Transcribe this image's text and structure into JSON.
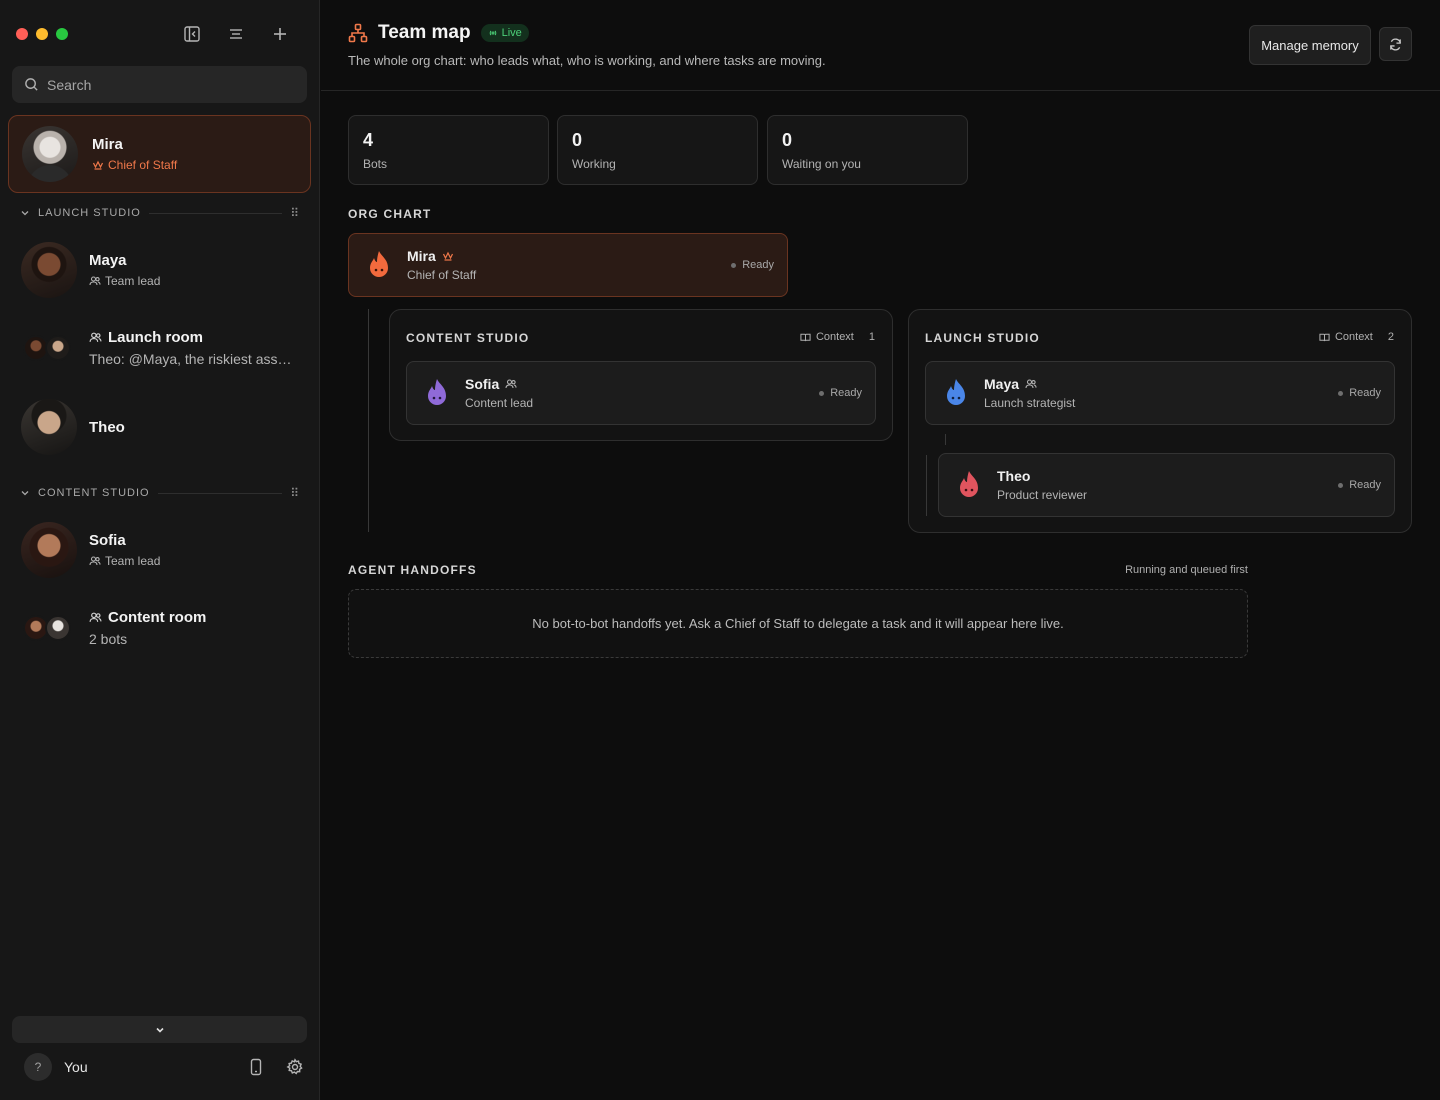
{
  "sidebar": {
    "search_placeholder": "Search",
    "pinned": {
      "name": "Mira",
      "role": "Chief of Staff"
    },
    "sections": [
      {
        "title": "LAUNCH STUDIO",
        "items": [
          {
            "name": "Maya",
            "sub": "Team lead",
            "kind": "bot"
          },
          {
            "name": "Launch room",
            "sub": "Theo: @Maya, the riskiest assu...",
            "kind": "room"
          },
          {
            "name": "Theo",
            "sub": "",
            "kind": "bot"
          }
        ]
      },
      {
        "title": "CONTENT STUDIO",
        "items": [
          {
            "name": "Sofia",
            "sub": "Team lead",
            "kind": "bot"
          },
          {
            "name": "Content room",
            "sub": "2 bots",
            "kind": "room"
          }
        ]
      }
    ],
    "footer": {
      "avatar_glyph": "?",
      "user_label": "You"
    }
  },
  "header": {
    "title": "Team map",
    "live_label": "Live",
    "subtitle": "The whole org chart: who leads what, who is working, and where tasks are moving.",
    "manage_memory_label": "Manage memory"
  },
  "stats": [
    {
      "value": "4",
      "label": "Bots"
    },
    {
      "value": "0",
      "label": "Working"
    },
    {
      "value": "0",
      "label": "Waiting on you"
    }
  ],
  "org_chart": {
    "label": "ORG CHART",
    "chief": {
      "name": "Mira",
      "role": "Chief of Staff",
      "status": "Ready"
    },
    "teams": [
      {
        "title": "CONTENT STUDIO",
        "context_label": "Context",
        "context_count": "1",
        "members": [
          {
            "name": "Sofia",
            "role": "Content lead",
            "status": "Ready"
          }
        ]
      },
      {
        "title": "LAUNCH STUDIO",
        "context_label": "Context",
        "context_count": "2",
        "members": [
          {
            "name": "Maya",
            "role": "Launch strategist",
            "status": "Ready"
          },
          {
            "name": "Theo",
            "role": "Product reviewer",
            "status": "Ready"
          }
        ]
      }
    ]
  },
  "handoffs": {
    "label": "AGENT HANDOFFS",
    "sort_note": "Running and queued first",
    "empty_text": "No bot-to-bot handoffs yet. Ask a Chief of Staff to delegate a task and it will appear here live."
  },
  "colors": {
    "accent_orange": "#f0784a",
    "live_green": "#4ccf78",
    "flame_orange": "#f26a3d",
    "flame_purple": "#8f6ad8",
    "flame_blue": "#4a86e8",
    "flame_red": "#e0545e"
  }
}
